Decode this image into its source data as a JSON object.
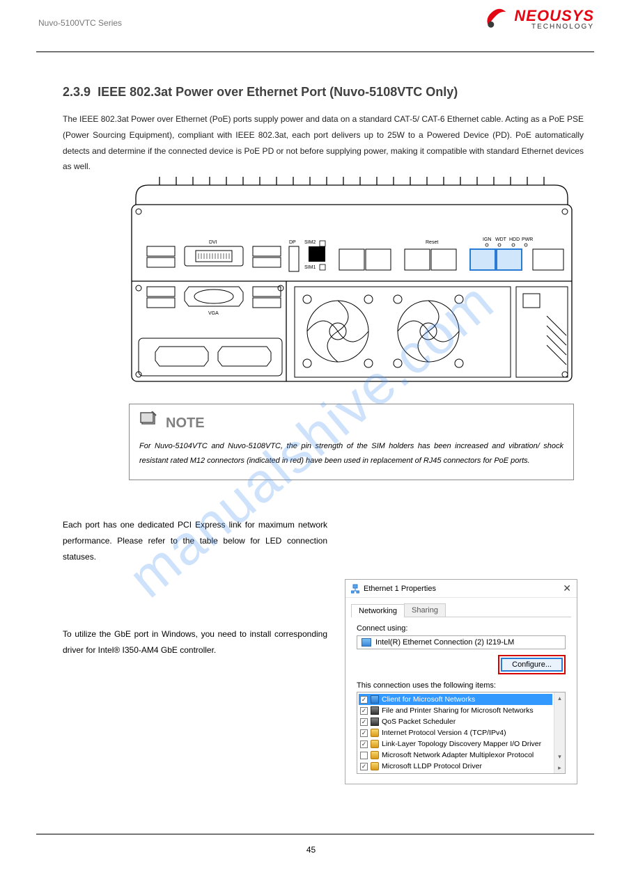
{
  "header": {
    "series": "Nuvo-5100VTC Series",
    "brand_main": "NEOUSYS",
    "brand_sub": "TECHNOLOGY"
  },
  "section": {
    "number": "2.3.9",
    "title": "IEEE 802.3at Power over Ethernet Port (Nuvo-5108VTC Only)",
    "intro": "The IEEE 802.3at Power over Ethernet (PoE) ports supply power and data on a standard CAT-5/ CAT-6 Ethernet cable. Acting as a PoE PSE (Power Sourcing Equipment), compliant with IEEE 802.3at, each port delivers up to 25W to a Powered Device (PD). PoE automatically detects and determine if the connected device is PoE PD or not before supplying power, making it compatible with standard Ethernet devices as well."
  },
  "note": {
    "title": "NOTE",
    "body": "For Nuvo-5104VTC and Nuvo-5108VTC, the pin strength of the SIM holders has been increased and vibration/ shock resistant rated M12 connectors (indicated in red) have been used in replacement of RJ45 connectors for PoE ports."
  },
  "para1": "Each port has one dedicated PCI Express link for maximum network performance. Please refer to the table below for LED connection statuses.",
  "para2": "To utilize the GbE port in Windows, you need to install corresponding driver for Intel® I350-AM4 GbE controller.",
  "diagram_labels": {
    "dvi": "DVI",
    "vga": "VGA",
    "dp": "DP",
    "sim1": "SIM1",
    "sim2": "SIM2",
    "reset": "Reset",
    "ign": "IGN",
    "wdt": "WDT",
    "hdd": "HDD",
    "pwr": "PWR"
  },
  "dialog": {
    "title": "Ethernet 1 Properties",
    "tab_networking": "Networking",
    "tab_sharing": "Sharing",
    "connect_using": "Connect using:",
    "adapter": "Intel(R) Ethernet Connection (2) I219-LM",
    "configure": "Configure...",
    "items_label": "This connection uses the following items:",
    "items": [
      {
        "checked": true,
        "icon": "net",
        "label": "Client for Microsoft Networks",
        "selected": true
      },
      {
        "checked": true,
        "icon": "share",
        "label": "File and Printer Sharing for Microsoft Networks",
        "selected": false
      },
      {
        "checked": true,
        "icon": "share",
        "label": "QoS Packet Scheduler",
        "selected": false
      },
      {
        "checked": true,
        "icon": "proto",
        "label": "Internet Protocol Version 4 (TCP/IPv4)",
        "selected": false
      },
      {
        "checked": true,
        "icon": "proto",
        "label": "Link-Layer Topology Discovery Mapper I/O Driver",
        "selected": false
      },
      {
        "checked": false,
        "icon": "proto",
        "label": "Microsoft Network Adapter Multiplexor Protocol",
        "selected": false
      },
      {
        "checked": true,
        "icon": "proto",
        "label": "Microsoft LLDP Protocol Driver",
        "selected": false
      }
    ]
  },
  "page_number": "45",
  "watermark": "manualshive.com"
}
